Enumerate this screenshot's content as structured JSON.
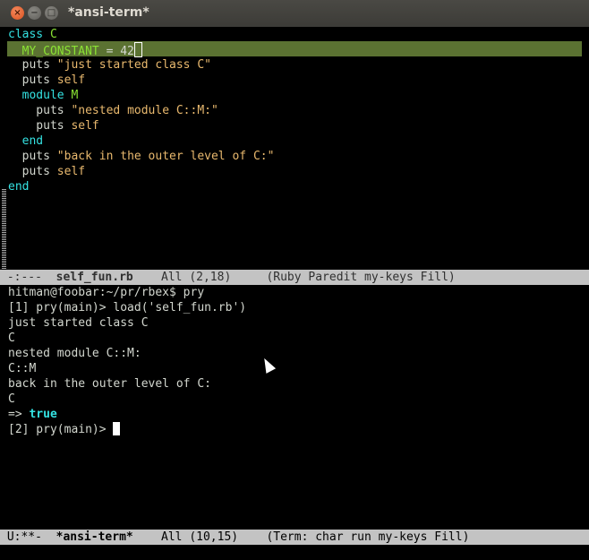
{
  "window": {
    "title": "*ansi-term*",
    "buttons": {
      "close": "×",
      "minimize": "−",
      "maximize": "□"
    }
  },
  "editor": {
    "lines": [
      {
        "parts": [
          [
            "kw",
            "class"
          ],
          [
            "",
            " "
          ],
          [
            "cst",
            "C"
          ]
        ]
      },
      {
        "parts": [
          [
            "cst",
            "  MY_CONSTANT"
          ],
          [
            "",
            " = 42"
          ]
        ],
        "highlight": true,
        "cursor": true
      },
      {
        "parts": [
          [
            "",
            "  puts "
          ],
          [
            "str",
            "\"just started class C\""
          ]
        ]
      },
      {
        "parts": [
          [
            "",
            "  puts "
          ],
          [
            "slf",
            "self"
          ]
        ]
      },
      {
        "parts": [
          [
            "kw",
            "  module"
          ],
          [
            "",
            " "
          ],
          [
            "cst",
            "M"
          ]
        ]
      },
      {
        "parts": [
          [
            "",
            "    puts "
          ],
          [
            "str",
            "\"nested module C::M:\""
          ]
        ]
      },
      {
        "parts": [
          [
            "",
            "    puts "
          ],
          [
            "slf",
            "self"
          ]
        ]
      },
      {
        "parts": [
          [
            "kw",
            "  end"
          ]
        ]
      },
      {
        "parts": [
          [
            "",
            "  puts "
          ],
          [
            "str",
            "\"back in the outer level of C:\""
          ]
        ]
      },
      {
        "parts": [
          [
            "",
            "  puts "
          ],
          [
            "slf",
            "self"
          ]
        ]
      },
      {
        "parts": [
          [
            "kw",
            "end"
          ]
        ]
      }
    ]
  },
  "modeline_top": {
    "status": " -:---  ",
    "buffer": "self_fun.rb",
    "position": "    All (2,18)     ",
    "modes": "(Ruby Paredit my-keys Fill)"
  },
  "terminal": {
    "lines": [
      {
        "parts": [
          [
            "",
            "hitman@foobar:~/pr/rbex$ pry"
          ]
        ]
      },
      {
        "parts": [
          [
            "",
            "[1] pry(main)> load('self_fun.rb')"
          ]
        ]
      },
      {
        "parts": [
          [
            "",
            "just started class C"
          ]
        ]
      },
      {
        "parts": [
          [
            "",
            "C"
          ]
        ]
      },
      {
        "parts": [
          [
            "",
            "nested module C::M:"
          ]
        ]
      },
      {
        "parts": [
          [
            "",
            "C::M"
          ]
        ]
      },
      {
        "parts": [
          [
            "",
            "back in the outer level of C:"
          ]
        ]
      },
      {
        "parts": [
          [
            "",
            "C"
          ]
        ]
      },
      {
        "parts": [
          [
            "",
            "=> "
          ],
          [
            "tr",
            "true"
          ]
        ]
      },
      {
        "parts": [
          [
            "",
            "[2] pry(main)> "
          ]
        ],
        "cursor": true
      }
    ]
  },
  "modeline_bottom": {
    "status": " U:**-  ",
    "buffer": "*ansi-term*",
    "position": "    All (10,15)    ",
    "modes": "(Term: char run my-keys Fill)"
  }
}
